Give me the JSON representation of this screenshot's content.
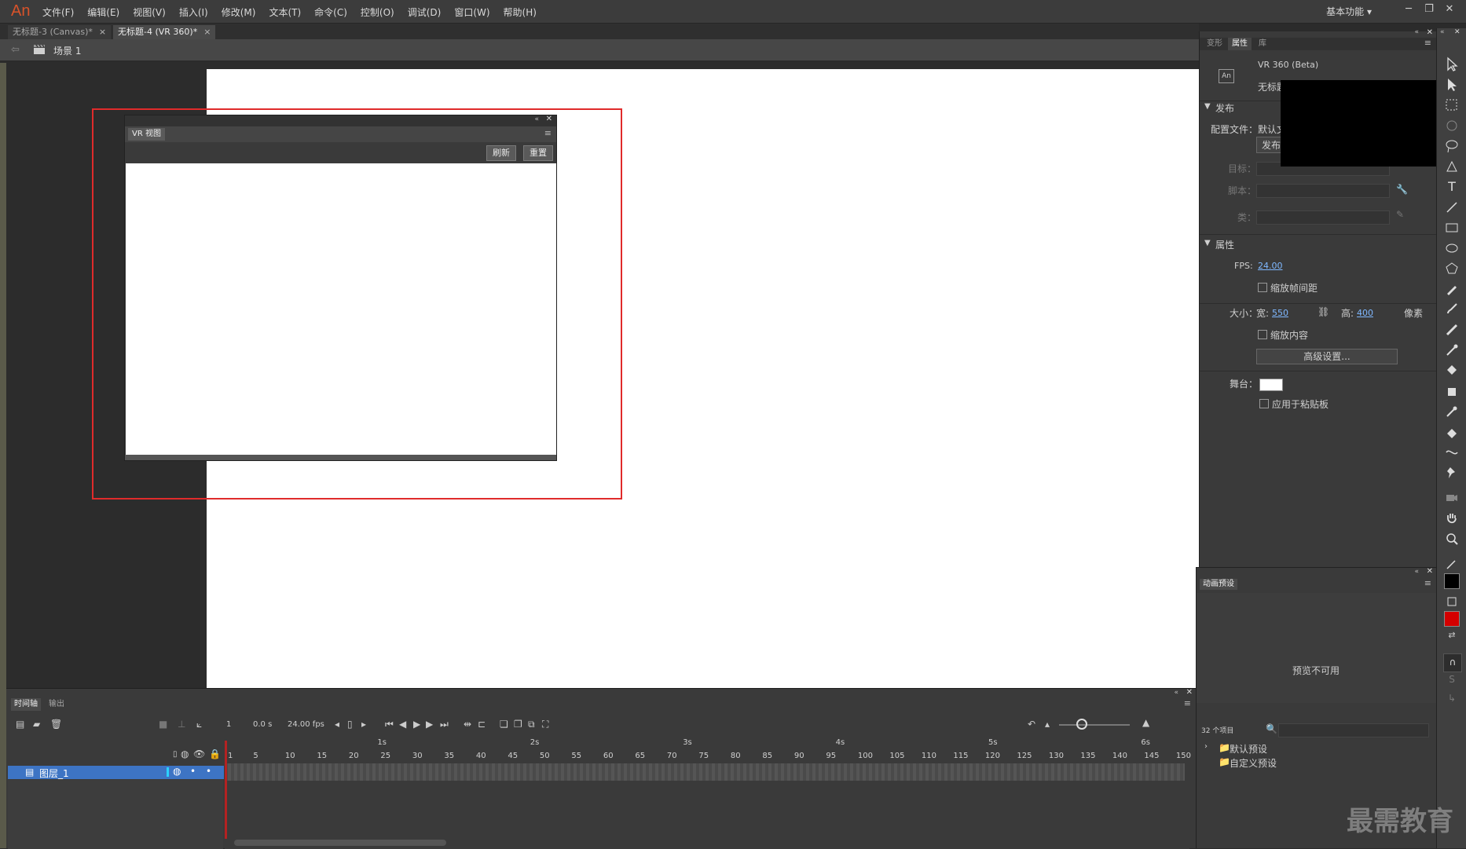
{
  "app": {
    "logo": "An",
    "workspace": "基本功能"
  },
  "menu": [
    "文件(F)",
    "编辑(E)",
    "视图(V)",
    "插入(I)",
    "修改(M)",
    "文本(T)",
    "命令(C)",
    "控制(O)",
    "调试(D)",
    "窗口(W)",
    "帮助(H)"
  ],
  "doc_tabs": [
    {
      "label": "无标题-3 (Canvas)*",
      "active": false
    },
    {
      "label": "无标题-4 (VR 360)*",
      "active": true
    }
  ],
  "scene": {
    "label": "场景 1"
  },
  "vr_panel": {
    "tab": "VR 视图",
    "refresh": "刷新",
    "reset": "重置"
  },
  "props": {
    "tabs": [
      "变形",
      "属性",
      "库"
    ],
    "doc_type": "VR 360 (Beta)",
    "doc_name": "无标题",
    "publish_section": "发布",
    "profile_label": "配置文件：默认文",
    "publish_btn": "发布",
    "target_label": "目标：",
    "script_label": "脚本：",
    "class_label": "类：",
    "attr_section": "属性",
    "fps_label": "FPS:",
    "fps_value": "24.00",
    "scale_spans": "缩放帧间距",
    "size_label": "大小：",
    "width_label": "宽:",
    "width_value": "550",
    "height_label": "高:",
    "height_value": "400",
    "unit": "像素",
    "scale_content": "缩放内容",
    "advanced": "高级设置...",
    "stage_label": "舞台：",
    "stage_color": "#ffffff",
    "apply_paste": "应用于粘贴板"
  },
  "presets": {
    "tab": "动画预设",
    "unavailable": "预览不可用",
    "count": "32 个项目",
    "folders": [
      "默认预设",
      "自定义预设"
    ]
  },
  "timeline": {
    "tabs": [
      "时间轴",
      "输出"
    ],
    "frame": "1",
    "time": "0.0 s",
    "fps": "24.00 fps",
    "layer": "图层_1",
    "ticks": [
      "1",
      "5",
      "10",
      "15",
      "20",
      "25",
      "30",
      "35",
      "40",
      "45",
      "50",
      "55",
      "60",
      "65",
      "70",
      "75",
      "80",
      "85",
      "90",
      "95",
      "100",
      "105",
      "110",
      "115",
      "120",
      "125",
      "130",
      "135",
      "140",
      "145",
      "150"
    ],
    "seconds": [
      "1s",
      "2s",
      "3s",
      "4s",
      "5s",
      "6s"
    ]
  },
  "colors": {
    "accent_red": "#e02b2b",
    "selection_blue": "#3d74c4",
    "fill_black": "#000000",
    "fill_red": "#d40000"
  },
  "watermark": "最需教育"
}
